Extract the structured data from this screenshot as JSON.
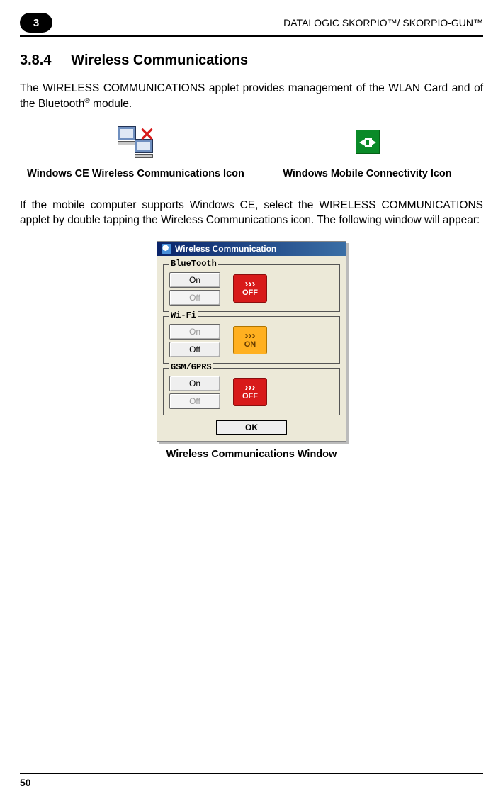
{
  "header": {
    "chapter": "3",
    "title": "DATALOGIC SKORPIO™/ SKORPIO-GUN™"
  },
  "section": {
    "number": "3.8.4",
    "title": "Wireless Communications"
  },
  "paragraphs": {
    "intro_a": "The WIRELESS COMMUNICATIONS applet provides management of the WLAN Card and of the Bluetooth",
    "intro_sup": "®",
    "intro_b": " module.",
    "body2": "If the mobile computer supports Windows CE, select the WIRELESS COMMUNICATIONS applet by double tapping the Wireless Communications icon. The following window will appear:"
  },
  "icons": {
    "ce_caption": "Windows CE Wireless Communications Icon",
    "wm_caption": "Windows Mobile Connectivity Icon"
  },
  "wc_window": {
    "title": "Wireless Communication",
    "groups": {
      "bluetooth": {
        "label": "BlueTooth",
        "on": "On",
        "off": "Off",
        "on_disabled": false,
        "off_disabled": true,
        "status": "OFF",
        "status_class": "off"
      },
      "wifi": {
        "label": "Wi-Fi",
        "on": "On",
        "off": "Off",
        "on_disabled": true,
        "off_disabled": false,
        "status": "ON",
        "status_class": "on"
      },
      "gsm": {
        "label": "GSM/GPRS",
        "on": "On",
        "off": "Off",
        "on_disabled": false,
        "off_disabled": true,
        "status": "OFF",
        "status_class": "off"
      }
    },
    "ok": "OK",
    "caption": "Wireless Communications Window"
  },
  "footer": {
    "page": "50"
  }
}
